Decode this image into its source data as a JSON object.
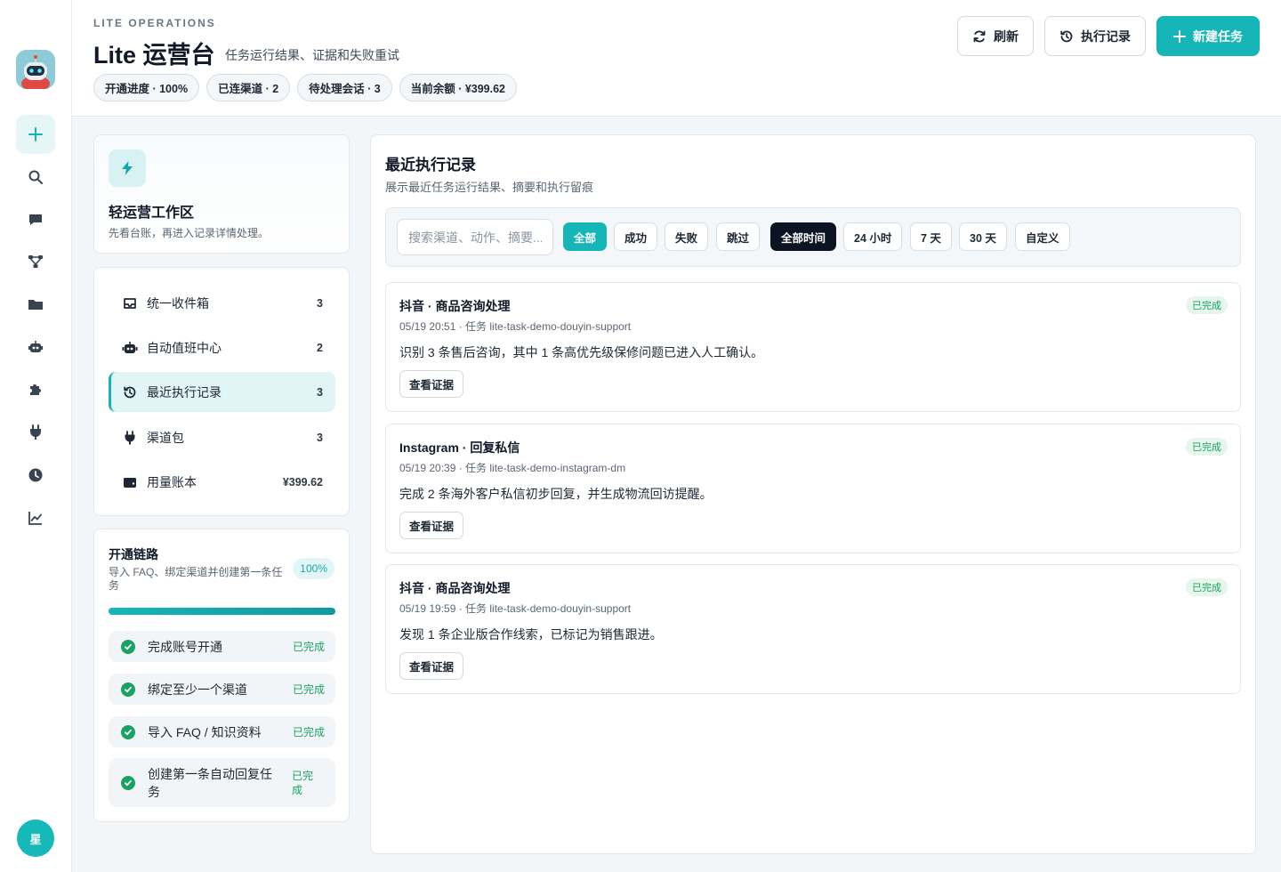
{
  "header": {
    "eyebrow": "LITE OPERATIONS",
    "title": "Lite 运营台",
    "subtitle": "任务运行结果、证据和失败重试",
    "chips": [
      "开通进度 · 100%",
      "已连渠道 · 2",
      "待处理会话 · 3",
      "当前余额 · ¥399.62"
    ],
    "actions": {
      "refresh": "刷新",
      "history": "执行记录",
      "new_task": "新建任务"
    }
  },
  "rail": {
    "icons": [
      "plus-icon",
      "search-icon",
      "chat-icon",
      "flow-icon",
      "folder-icon",
      "robot-icon",
      "puzzle-icon",
      "plug-icon",
      "clock-icon",
      "chart-icon"
    ],
    "avatar": "星"
  },
  "workspace": {
    "title": "轻运营工作区",
    "desc": "先看台账，再进入记录详情处理。"
  },
  "nav": {
    "items": [
      {
        "label": "统一收件箱",
        "count": "3",
        "icon": "inbox-icon"
      },
      {
        "label": "自动值班中心",
        "count": "2",
        "icon": "robot-icon"
      },
      {
        "label": "最近执行记录",
        "count": "3",
        "icon": "history-icon"
      },
      {
        "label": "渠道包",
        "count": "3",
        "icon": "plug-icon"
      },
      {
        "label": "用量账本",
        "count": "¥399.62",
        "icon": "wallet-icon"
      }
    ]
  },
  "progress": {
    "title": "开通链路",
    "desc": "导入 FAQ、绑定渠道并创建第一条任务",
    "badge": "100%",
    "value": 1.0,
    "steps": [
      {
        "label": "完成账号开通",
        "status": "已完成"
      },
      {
        "label": "绑定至少一个渠道",
        "status": "已完成"
      },
      {
        "label": "导入 FAQ / 知识资料",
        "status": "已完成"
      },
      {
        "label": "创建第一条自动回复任务",
        "status": "已完成"
      }
    ]
  },
  "main": {
    "title": "最近执行记录",
    "desc": "展示最近任务运行结果、摘要和执行留痕",
    "search_placeholder": "搜索渠道、动作、摘要...",
    "status_filters": [
      "全部",
      "成功",
      "失败",
      "跳过"
    ],
    "time_filters": [
      "全部时间",
      "24 小时",
      "7 天",
      "30 天",
      "自定义"
    ],
    "records": [
      {
        "title": "抖音 · 商品咨询处理",
        "meta": "05/19 20:51 · 任务 lite-task-demo-douyin-support",
        "body": "识别 3 条售后咨询，其中 1 条高优先级保修问题已进入人工确认。",
        "button": "查看证据",
        "status": "已完成"
      },
      {
        "title": "Instagram · 回复私信",
        "meta": "05/19 20:39 · 任务 lite-task-demo-instagram-dm",
        "body": "完成 2 条海外客户私信初步回复，并生成物流回访提醒。",
        "button": "查看证据",
        "status": "已完成"
      },
      {
        "title": "抖音 · 商品咨询处理",
        "meta": "05/19 19:59 · 任务 lite-task-demo-douyin-support",
        "body": "发现 1 条企业版合作线索，已标记为销售跟进。",
        "button": "查看证据",
        "status": "已完成"
      }
    ]
  },
  "colors": {
    "accent": "#16b6b8",
    "success": "#1aa260",
    "dark": "#0c1322"
  }
}
